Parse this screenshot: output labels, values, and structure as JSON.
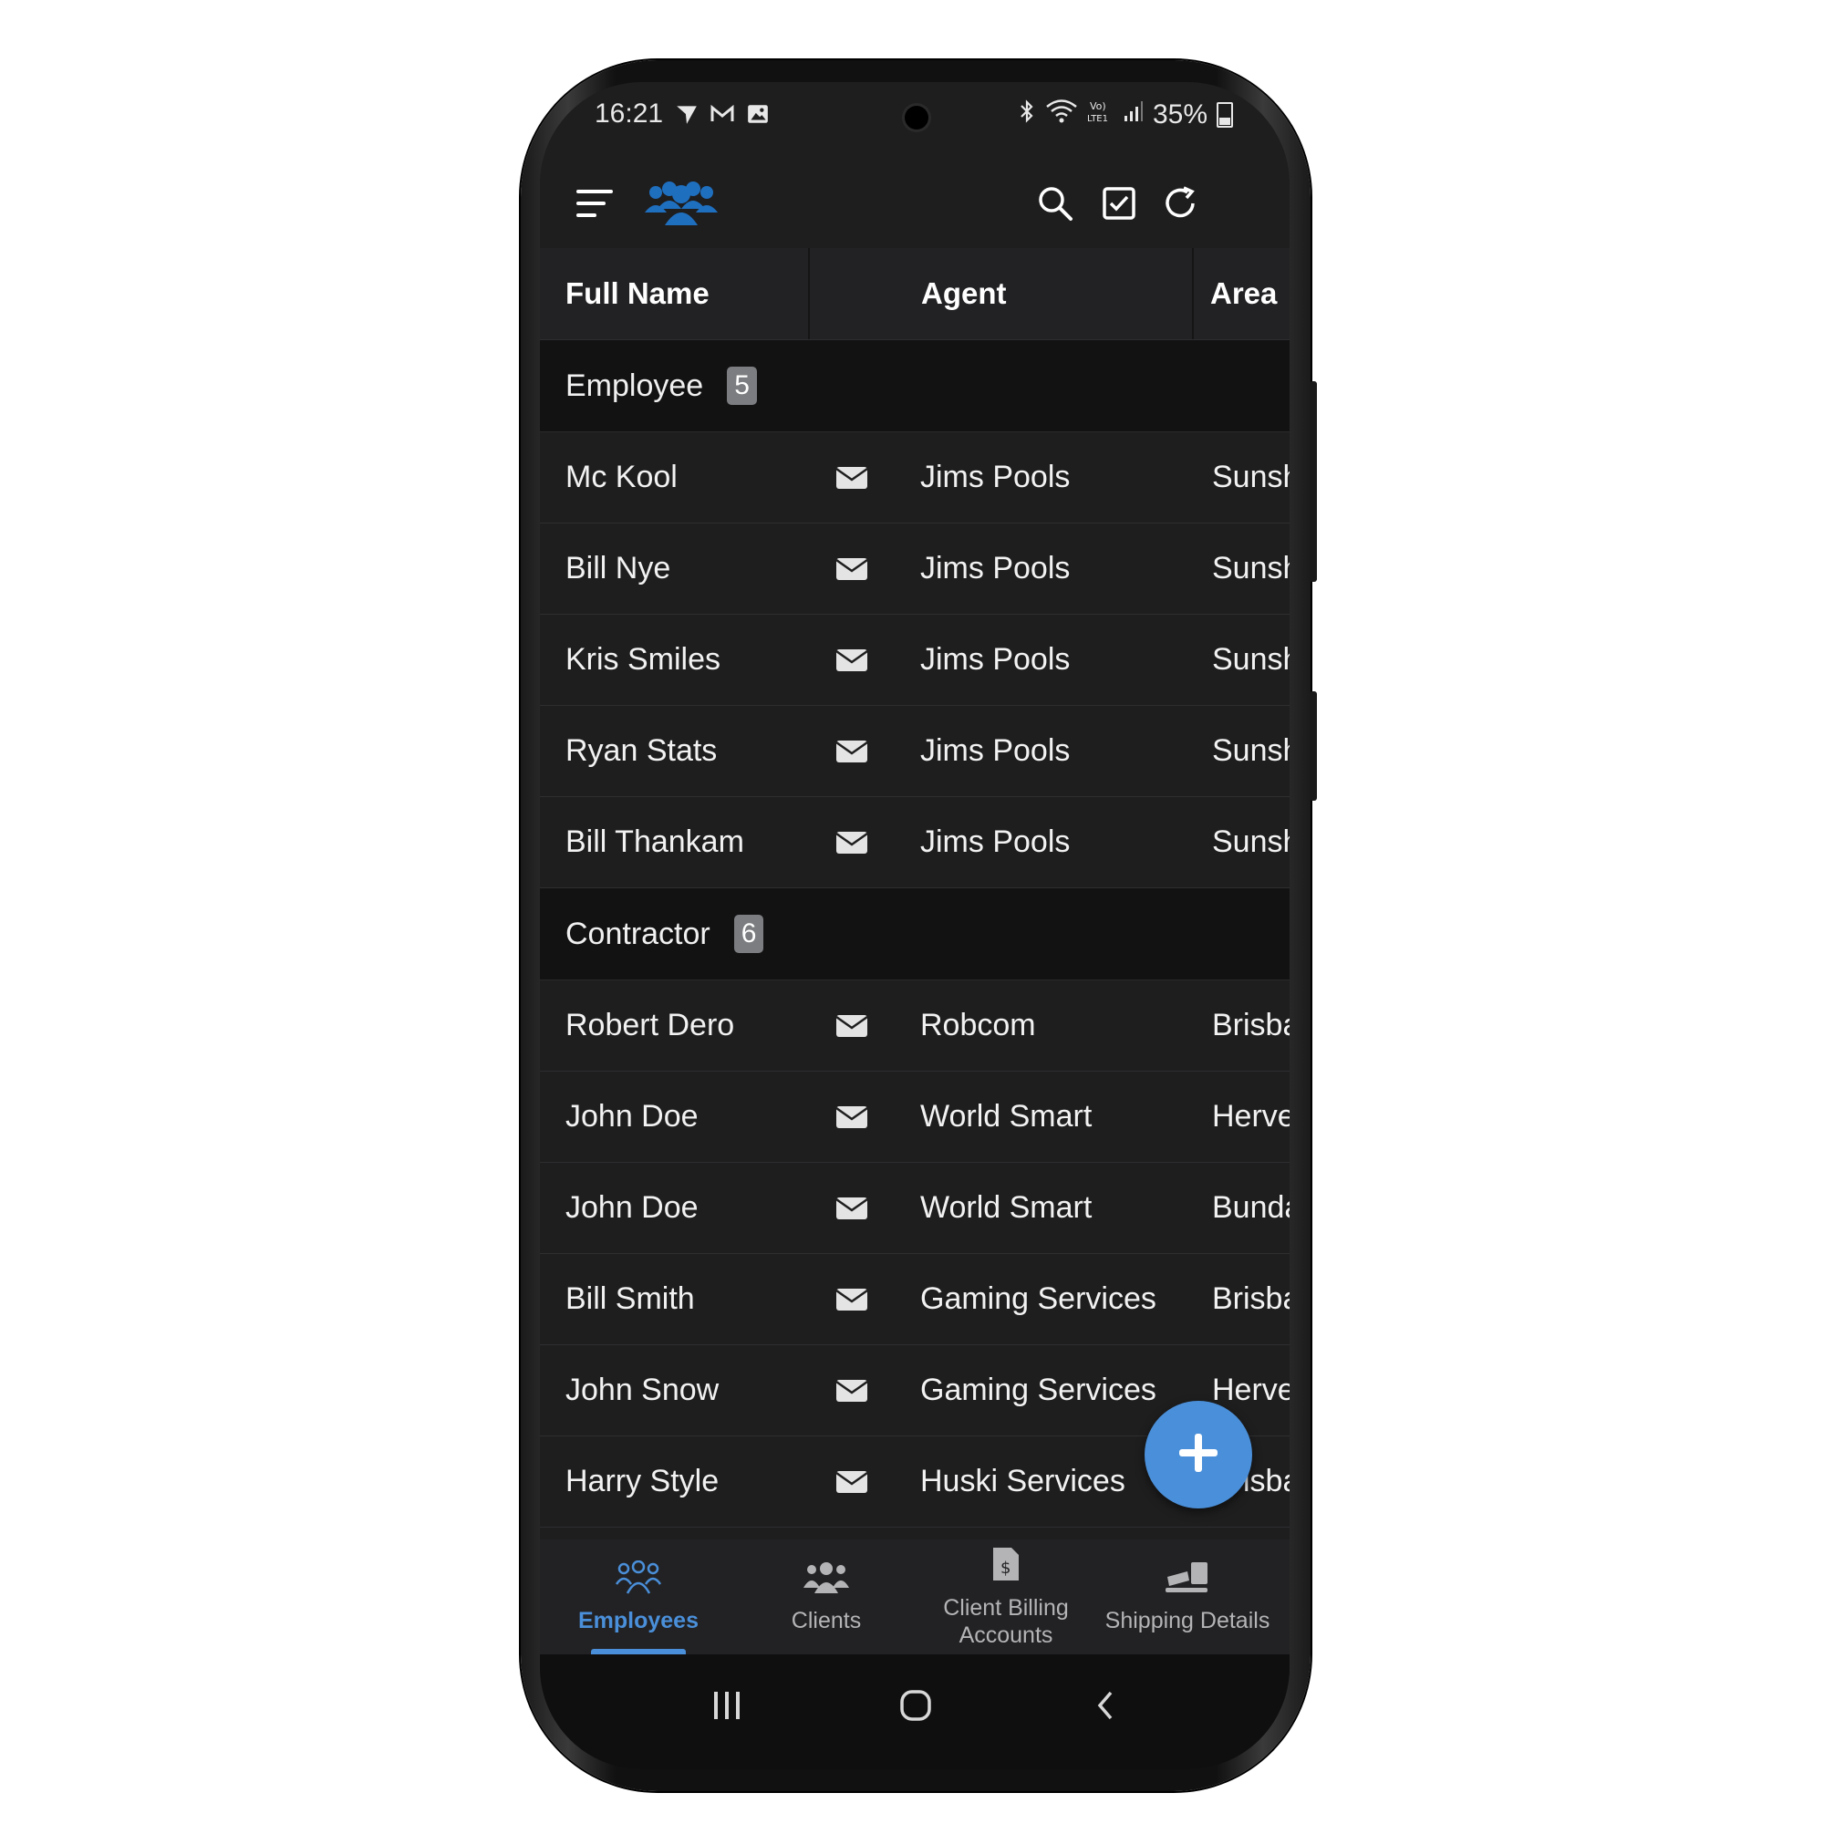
{
  "status_bar": {
    "time": "16:21",
    "battery": "35%"
  },
  "table": {
    "headers": {
      "full_name": "Full Name",
      "agent": "Agent",
      "area": "Area"
    },
    "groups": [
      {
        "label": "Employee",
        "count": "5",
        "rows": [
          {
            "name": "Mc Kool",
            "agent": "Jims Pools",
            "area": "Sunsh"
          },
          {
            "name": "Bill Nye",
            "agent": "Jims Pools",
            "area": "Sunsh"
          },
          {
            "name": "Kris Smiles",
            "agent": "Jims Pools",
            "area": "Sunsh"
          },
          {
            "name": "Ryan Stats",
            "agent": "Jims Pools",
            "area": "Sunsh"
          },
          {
            "name": "Bill Thankam",
            "agent": "Jims Pools",
            "area": "Sunsh"
          }
        ]
      },
      {
        "label": "Contractor",
        "count": "6",
        "rows": [
          {
            "name": "Robert Dero",
            "agent": "Robcom",
            "area": "Brisba"
          },
          {
            "name": "John Doe",
            "agent": "World Smart",
            "area": "Herve"
          },
          {
            "name": "John Doe",
            "agent": "World Smart",
            "area": "Bunda"
          },
          {
            "name": "Bill Smith",
            "agent": "Gaming Services",
            "area": "Brisba"
          },
          {
            "name": "John Snow",
            "agent": "Gaming Services",
            "area": "Herve"
          },
          {
            "name": "Harry Style",
            "agent": "Huski Services",
            "area": "Brisba"
          }
        ]
      }
    ]
  },
  "bottom_nav": [
    {
      "label": "Employees",
      "icon": "employees-icon",
      "active": true
    },
    {
      "label": "Clients",
      "icon": "clients-icon",
      "active": false
    },
    {
      "label": "Client Billing Accounts",
      "icon": "billing-icon",
      "active": false
    },
    {
      "label": "Shipping Details",
      "icon": "shipping-icon",
      "active": false
    }
  ],
  "colors": {
    "accent": "#4a8fd9",
    "background": "#1e1e1f",
    "group_background": "#121213"
  }
}
